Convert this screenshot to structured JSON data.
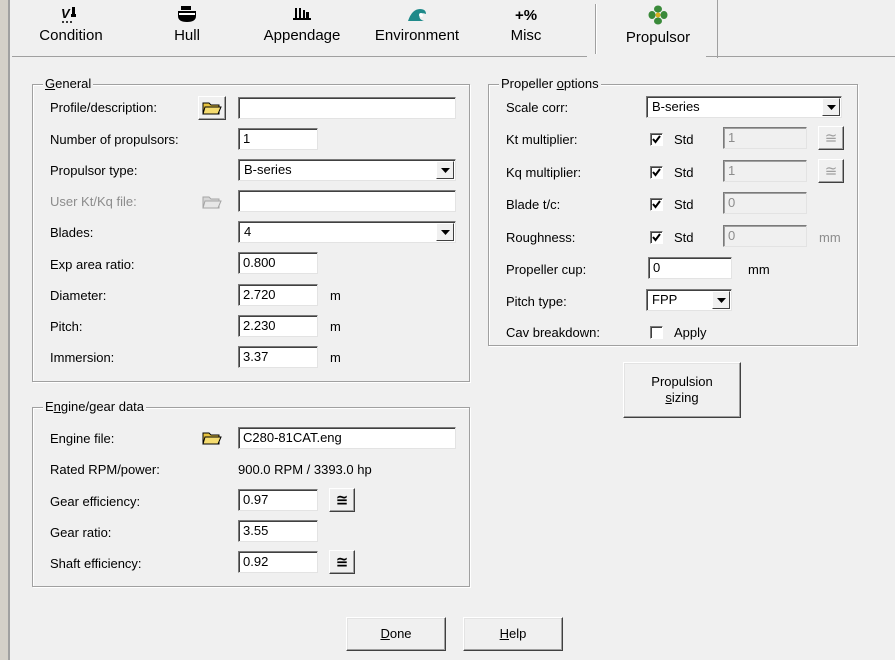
{
  "toolbar": {
    "items": [
      {
        "label": "Condition",
        "icon": "condition-icon"
      },
      {
        "label": "Hull",
        "icon": "hull-icon"
      },
      {
        "label": "Appendage",
        "icon": "appendage-icon"
      },
      {
        "label": "Environment",
        "icon": "environment-icon"
      },
      {
        "label": "Misc",
        "icon": "misc-icon",
        "glyph": "+%"
      },
      {
        "label": "Propulsor",
        "icon": "propulsor-icon"
      }
    ],
    "active": "Propulsor"
  },
  "general": {
    "title_pre": "",
    "title_u": "G",
    "title_post": "eneral",
    "profile_label": "Profile/description:",
    "profile_value": "",
    "num_propulsors_label": "Number of propulsors:",
    "num_propulsors_value": "1",
    "propulsor_type_label": "Propulsor type:",
    "propulsor_type_value": "B-series",
    "user_ktkq_label": "User Kt/Kq file:",
    "user_ktkq_value": "",
    "blades_label": "Blades:",
    "blades_value": "4",
    "exp_area_label": "Exp area ratio:",
    "exp_area_value": "0.800",
    "diameter_label": "Diameter:",
    "diameter_value": "2.720",
    "diameter_unit": "m",
    "pitch_label": "Pitch:",
    "pitch_value": "2.230",
    "pitch_unit": "m",
    "immersion_label": "Immersion:",
    "immersion_value": "3.37",
    "immersion_unit": "m"
  },
  "engine": {
    "title_pre": "E",
    "title_u": "n",
    "title_post": "gine/gear data",
    "engine_file_label": "Engine file:",
    "engine_file_value": "C280-81CAT.eng",
    "rated_label": "Rated RPM/power:",
    "rated_value": "900.0 RPM / 3393.0 hp",
    "gear_eff_label": "Gear efficiency:",
    "gear_eff_value": "0.97",
    "gear_ratio_label": "Gear ratio:",
    "gear_ratio_value": "3.55",
    "shaft_eff_label": "Shaft efficiency:",
    "shaft_eff_value": "0.92"
  },
  "prop_options": {
    "title_pre": "Propeller ",
    "title_u": "o",
    "title_post": "ptions",
    "scale_corr_label": "Scale corr:",
    "scale_corr_value": "B-series",
    "kt_label": "Kt multiplier:",
    "kt_std_label": "Std",
    "kt_std_checked": true,
    "kt_value": "1",
    "kq_label": "Kq multiplier:",
    "kq_std_label": "Std",
    "kq_std_checked": true,
    "kq_value": "1",
    "blade_tc_label": "Blade t/c:",
    "blade_tc_std_label": "Std",
    "blade_tc_std_checked": true,
    "blade_tc_value": "0",
    "roughness_label": "Roughness:",
    "roughness_std_label": "Std",
    "roughness_std_checked": true,
    "roughness_value": "0",
    "roughness_unit": "mm",
    "cup_label": "Propeller cup:",
    "cup_value": "0",
    "cup_unit": "mm",
    "pitch_type_label": "Pitch type:",
    "pitch_type_value": "FPP",
    "cav_label": "Cav breakdown:",
    "cav_apply_label": "Apply",
    "cav_apply_checked": false
  },
  "propulsion_sizing": {
    "line1": "Propulsion",
    "line2_u": "s",
    "line2_post": "izing"
  },
  "buttons": {
    "done_u": "D",
    "done_post": "one",
    "help_u": "H",
    "help_post": "elp"
  },
  "approx_symbol": "≅",
  "colors": {
    "dialog_bg": "#f0f0f0",
    "disabled_text": "#8c8c8c",
    "folder_yellow": "#e8c440"
  }
}
